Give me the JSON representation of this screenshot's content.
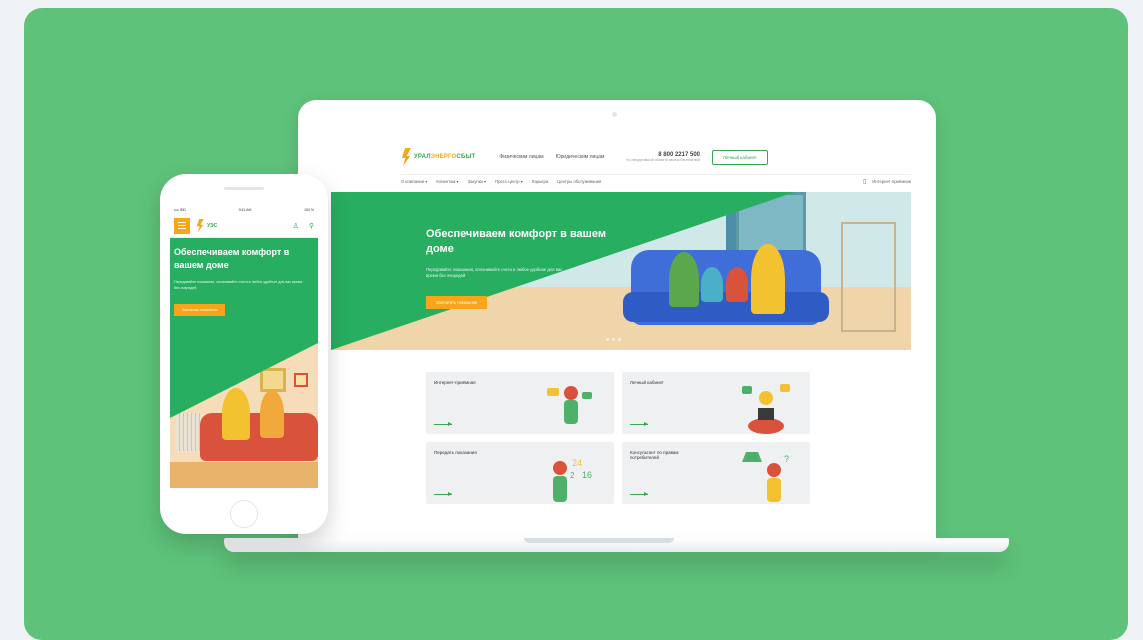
{
  "desktop": {
    "logo": {
      "part1": "УРАЛ",
      "part2": "ЭНЕРГО",
      "part3": "СБЫТ"
    },
    "header_links": [
      "Физическим лицам",
      "Юридическим лицам"
    ],
    "phone": "8 800 2217 500",
    "phone_note": "по свердловской области звонок бесплатный",
    "cabinet_button": "Личный кабинет",
    "nav": [
      "О компании ▾",
      "Клиентам ▾",
      "Закупки ▾",
      "Пресс-центр ▾",
      "Карьера",
      "Центры обслуживания"
    ],
    "nav_right": "Интернет-приёмная",
    "hero": {
      "title": "Обеспечиваем комфорт в вашем доме",
      "text": "Передавайте показания, оплачивайте счета в любое удобное для вас время без очередей",
      "button": "Заплатить показания"
    },
    "tiles": [
      {
        "label": "Интернет-приёмная"
      },
      {
        "label": "Личный кабинет"
      },
      {
        "label": "Передать показания"
      },
      {
        "label": "Консультант по правам потребителей"
      }
    ]
  },
  "mobile": {
    "status": {
      "carrier": "•••• IDD",
      "time": "9:41 AM",
      "battery": "100 %"
    },
    "logo": "УЭС",
    "hero": {
      "title": "Обеспечиваем комфорт в вашем доме",
      "text": "Передавайте показания, оплачивайте счета в любое удобное для вас время без очередей",
      "button": "Заплатить показания"
    }
  },
  "colors": {
    "brand_green": "#27ae60",
    "accent_orange": "#f7a61c",
    "card_bg": "#5ec27a"
  }
}
